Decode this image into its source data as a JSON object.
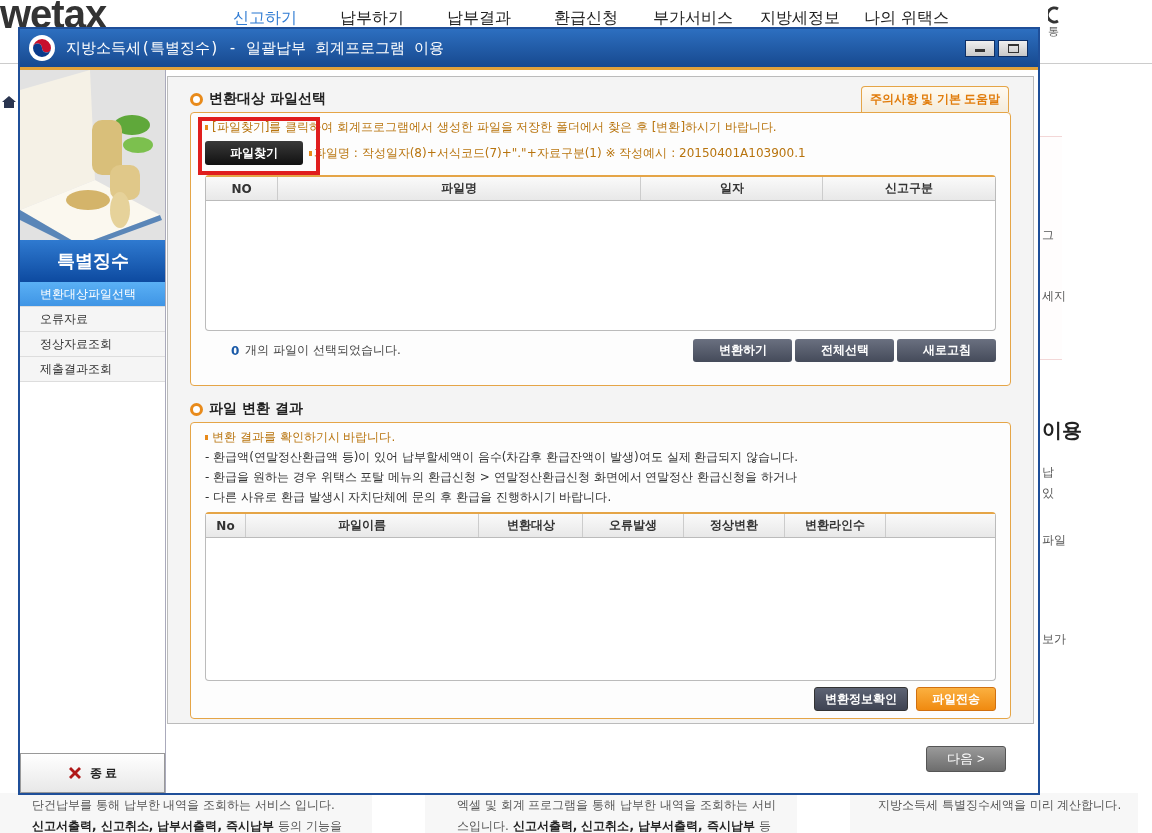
{
  "site": {
    "logo": "wetax",
    "nav": [
      {
        "label": "신고하기",
        "selected": true
      },
      {
        "label": "납부하기",
        "selected": false
      },
      {
        "label": "납부결과",
        "selected": false
      },
      {
        "label": "환급신청",
        "selected": false
      },
      {
        "label": "부가서비스",
        "selected": false
      },
      {
        "label": "지방세정보",
        "selected": false
      },
      {
        "label": "나의 위택스",
        "selected": false
      }
    ],
    "corner_text": "통",
    "side_fragments": [
      "그",
      "세지",
      "이용",
      "납",
      "있",
      "파일",
      "보가"
    ],
    "bottom_columns": [
      {
        "lines": [
          "단건납부를 통해 납부한 내역을 조회하는 서비스 입니다.",
          "**신고서출력, 신고취소, 납부서출력, 즉시납부** 등의 기능을"
        ]
      },
      {
        "lines": [
          "엑셀 및 회계 프로그램을 통해 납부한 내역을 조회하는 서비",
          "스입니다. **신고서출력, 신고취소, 납부서출력, 즉시납부** 등"
        ]
      },
      {
        "lines": [
          "지방소득세 특별징수세액을 미리 계산합니다."
        ]
      }
    ]
  },
  "window": {
    "title": "지방소득세(특별징수) - 일괄납부 회계프로그램 이용"
  },
  "sidebar": {
    "heading": "특별징수",
    "items": [
      {
        "label": "변환대상파일선택",
        "selected": true
      },
      {
        "label": "오류자료",
        "selected": false
      },
      {
        "label": "정상자료조회",
        "selected": false
      },
      {
        "label": "제출결과조회",
        "selected": false
      }
    ],
    "exit_button": "종 료"
  },
  "file_select": {
    "title": "변환대상 파일선택",
    "help_tab": "주의사항 및 기본 도움말",
    "notice": "[파일찾기]를 클릭하여 회계프로그램에서 생성한 파일을 저장한 폴더에서 찾은 후 [변환]하시기 바랍니다.",
    "find_button": "파일찾기",
    "file_name_hint": "파일명 : 작성일자(8)+서식코드(7)+\".\"+자료구분(1)  ※ 작성예시 : 20150401A103900.1",
    "highlighted": true,
    "table": {
      "columns": [
        "NO",
        "파일명",
        "일자",
        "신고구분"
      ]
    },
    "selected_count": "0",
    "selected_text": "개의 파일이 선택되었습니다.",
    "buttons": [
      "변환하기",
      "전체선택",
      "새로고침"
    ]
  },
  "conversion_result": {
    "title": "파일 변환 결과",
    "notice": "변환 결과를 확인하기시 바랍니다.",
    "lines": [
      "- 환급액(연말정산환급액 등)이 있어 납부할세액이 음수(차감후 환급잔액이 발생)여도 실제 환급되지 않습니다.",
      "- 환급을 원하는 경우 위택스 포탈 메뉴의 환급신청 > 연말정산환급신청 화면에서 연말정산 환급신청을 하거나",
      "- 다른 사유로 환급 발생시 자치단체에 문의 후 환급을 진행하시기 바랍니다."
    ],
    "table": {
      "columns": [
        "No",
        "파일이름",
        "변환대상",
        "오류발생",
        "정상변환",
        "변환라인수"
      ]
    },
    "buttons": [
      {
        "label": "변환정보확인",
        "kind": "dark"
      },
      {
        "label": "파일전송",
        "kind": "orange"
      }
    ]
  },
  "next_button": "다음 >"
}
